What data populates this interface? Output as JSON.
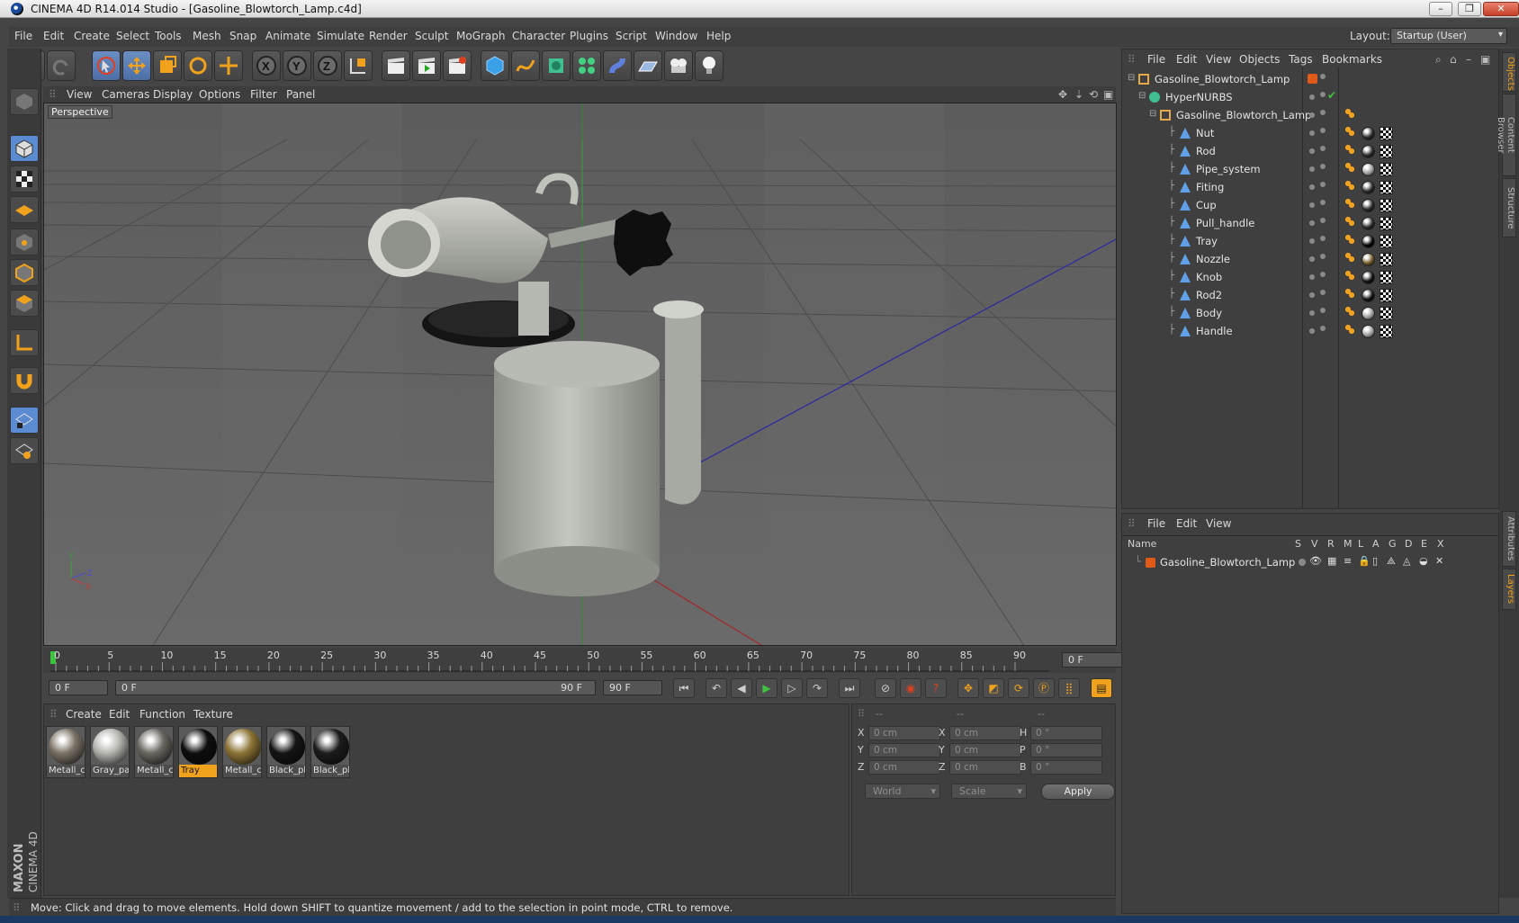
{
  "window": {
    "title": "CINEMA 4D R14.014 Studio - [Gasoline_Blowtorch_Lamp.c4d]",
    "buttons": [
      "minimize",
      "restore",
      "close"
    ]
  },
  "menubar": [
    "File",
    "Edit",
    "Create",
    "Select",
    "Tools",
    "Mesh",
    "Snap",
    "Animate",
    "Simulate",
    "Render",
    "Sculpt",
    "MoGraph",
    "Character",
    "Plugins",
    "Script",
    "Window",
    "Help"
  ],
  "layout": {
    "label": "Layout:",
    "value": "Startup (User)"
  },
  "viewport": {
    "menu": [
      "View",
      "Cameras",
      "Display",
      "Options",
      "Filter",
      "Panel"
    ],
    "label": "Perspective",
    "axis": {
      "y": "Y",
      "z": "Z",
      "x": "X"
    }
  },
  "timeline": {
    "ticks": [
      "0",
      "5",
      "10",
      "15",
      "20",
      "25",
      "30",
      "35",
      "40",
      "45",
      "50",
      "55",
      "60",
      "65",
      "70",
      "75",
      "80",
      "85",
      "90"
    ],
    "current_frame": "0 F",
    "start_field": "0 F",
    "range_start": "0 F",
    "range_end": "90 F",
    "end_field": "90 F"
  },
  "materials": {
    "menu": [
      "Create",
      "Edit",
      "Function",
      "Texture"
    ],
    "items": [
      {
        "label": "Metall_c",
        "color": "#7a7266",
        "selected": false
      },
      {
        "label": "Gray_pa",
        "color": "#b5b5b0",
        "selected": false
      },
      {
        "label": "Metall_c",
        "color": "#6a6660",
        "selected": false
      },
      {
        "label": "Tray",
        "color": "#0e0e0e",
        "selected": true
      },
      {
        "label": "Metall_c",
        "color": "#8d7436",
        "selected": false
      },
      {
        "label": "Black_pl",
        "color": "#141414",
        "selected": false
      },
      {
        "label": "Black_pl",
        "color": "#1c1c1c",
        "selected": false
      }
    ]
  },
  "coords": {
    "headers": [
      "--",
      "--",
      "--"
    ],
    "rows": [
      {
        "a": "X",
        "av": "0 cm",
        "b": "X",
        "bv": "0 cm",
        "c": "H",
        "cv": "0 °"
      },
      {
        "a": "Y",
        "av": "0 cm",
        "b": "Y",
        "bv": "0 cm",
        "c": "P",
        "cv": "0 °"
      },
      {
        "a": "Z",
        "av": "0 cm",
        "b": "Z",
        "bv": "0 cm",
        "c": "B",
        "cv": "0 °"
      }
    ],
    "space": "World",
    "mode": "Scale",
    "apply": "Apply"
  },
  "objects": {
    "menu": [
      "File",
      "Edit",
      "View",
      "Objects",
      "Tags",
      "Bookmarks"
    ],
    "root": "Gasoline_Blowtorch_Lamp",
    "hypernurbs": "HyperNURBS",
    "group": "Gasoline_Blowtorch_Lamp",
    "children": [
      {
        "name": "Nut",
        "tag": "#2a2a2a"
      },
      {
        "name": "Rod",
        "tag": "#2a2a2a"
      },
      {
        "name": "Pipe_system",
        "tag": "#9a9a9a"
      },
      {
        "name": "Fiting",
        "tag": "#2a2a2a"
      },
      {
        "name": "Cup",
        "tag": "#2a2a2a"
      },
      {
        "name": "Pull_handle",
        "tag": "#2a2a2a"
      },
      {
        "name": "Tray",
        "tag": "#050505"
      },
      {
        "name": "Nozzle",
        "tag": "#6e5a28"
      },
      {
        "name": "Knob",
        "tag": "#111111"
      },
      {
        "name": "Rod2",
        "tag": "#111111"
      },
      {
        "name": "Body",
        "tag": "#9a9a9a"
      },
      {
        "name": "Handle",
        "tag": "#9a9a9a"
      }
    ]
  },
  "layers": {
    "menu": [
      "File",
      "Edit",
      "View"
    ],
    "columns": [
      "Name",
      "S",
      "V",
      "R",
      "M",
      "L",
      "A",
      "G",
      "D",
      "E",
      "X"
    ],
    "rows": [
      "Gasoline_Blowtorch_Lamp"
    ]
  },
  "right_tabs": [
    "Objects",
    "Content Browser",
    "Structure",
    "Attributes",
    "Layers"
  ],
  "brand": {
    "line1": "MAXON",
    "line2": "CINEMA 4D"
  },
  "status": "Move: Click and drag to move elements. Hold down SHIFT to quantize movement / add to the selection in point mode, CTRL to remove.",
  "colors": {
    "accent": "#f0a21c",
    "selection": "#5b8bd0",
    "layer": "#e05a1a"
  }
}
